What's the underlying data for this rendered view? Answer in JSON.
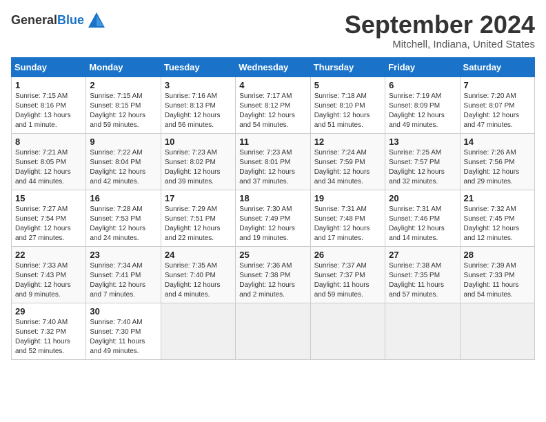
{
  "header": {
    "logo_line1": "General",
    "logo_line2": "Blue",
    "month_title": "September 2024",
    "location": "Mitchell, Indiana, United States"
  },
  "weekdays": [
    "Sunday",
    "Monday",
    "Tuesday",
    "Wednesday",
    "Thursday",
    "Friday",
    "Saturday"
  ],
  "weeks": [
    [
      {
        "day": "1",
        "info": "Sunrise: 7:15 AM\nSunset: 8:16 PM\nDaylight: 13 hours\nand 1 minute."
      },
      {
        "day": "2",
        "info": "Sunrise: 7:15 AM\nSunset: 8:15 PM\nDaylight: 12 hours\nand 59 minutes."
      },
      {
        "day": "3",
        "info": "Sunrise: 7:16 AM\nSunset: 8:13 PM\nDaylight: 12 hours\nand 56 minutes."
      },
      {
        "day": "4",
        "info": "Sunrise: 7:17 AM\nSunset: 8:12 PM\nDaylight: 12 hours\nand 54 minutes."
      },
      {
        "day": "5",
        "info": "Sunrise: 7:18 AM\nSunset: 8:10 PM\nDaylight: 12 hours\nand 51 minutes."
      },
      {
        "day": "6",
        "info": "Sunrise: 7:19 AM\nSunset: 8:09 PM\nDaylight: 12 hours\nand 49 minutes."
      },
      {
        "day": "7",
        "info": "Sunrise: 7:20 AM\nSunset: 8:07 PM\nDaylight: 12 hours\nand 47 minutes."
      }
    ],
    [
      {
        "day": "8",
        "info": "Sunrise: 7:21 AM\nSunset: 8:05 PM\nDaylight: 12 hours\nand 44 minutes."
      },
      {
        "day": "9",
        "info": "Sunrise: 7:22 AM\nSunset: 8:04 PM\nDaylight: 12 hours\nand 42 minutes."
      },
      {
        "day": "10",
        "info": "Sunrise: 7:23 AM\nSunset: 8:02 PM\nDaylight: 12 hours\nand 39 minutes."
      },
      {
        "day": "11",
        "info": "Sunrise: 7:23 AM\nSunset: 8:01 PM\nDaylight: 12 hours\nand 37 minutes."
      },
      {
        "day": "12",
        "info": "Sunrise: 7:24 AM\nSunset: 7:59 PM\nDaylight: 12 hours\nand 34 minutes."
      },
      {
        "day": "13",
        "info": "Sunrise: 7:25 AM\nSunset: 7:57 PM\nDaylight: 12 hours\nand 32 minutes."
      },
      {
        "day": "14",
        "info": "Sunrise: 7:26 AM\nSunset: 7:56 PM\nDaylight: 12 hours\nand 29 minutes."
      }
    ],
    [
      {
        "day": "15",
        "info": "Sunrise: 7:27 AM\nSunset: 7:54 PM\nDaylight: 12 hours\nand 27 minutes."
      },
      {
        "day": "16",
        "info": "Sunrise: 7:28 AM\nSunset: 7:53 PM\nDaylight: 12 hours\nand 24 minutes."
      },
      {
        "day": "17",
        "info": "Sunrise: 7:29 AM\nSunset: 7:51 PM\nDaylight: 12 hours\nand 22 minutes."
      },
      {
        "day": "18",
        "info": "Sunrise: 7:30 AM\nSunset: 7:49 PM\nDaylight: 12 hours\nand 19 minutes."
      },
      {
        "day": "19",
        "info": "Sunrise: 7:31 AM\nSunset: 7:48 PM\nDaylight: 12 hours\nand 17 minutes."
      },
      {
        "day": "20",
        "info": "Sunrise: 7:31 AM\nSunset: 7:46 PM\nDaylight: 12 hours\nand 14 minutes."
      },
      {
        "day": "21",
        "info": "Sunrise: 7:32 AM\nSunset: 7:45 PM\nDaylight: 12 hours\nand 12 minutes."
      }
    ],
    [
      {
        "day": "22",
        "info": "Sunrise: 7:33 AM\nSunset: 7:43 PM\nDaylight: 12 hours\nand 9 minutes."
      },
      {
        "day": "23",
        "info": "Sunrise: 7:34 AM\nSunset: 7:41 PM\nDaylight: 12 hours\nand 7 minutes."
      },
      {
        "day": "24",
        "info": "Sunrise: 7:35 AM\nSunset: 7:40 PM\nDaylight: 12 hours\nand 4 minutes."
      },
      {
        "day": "25",
        "info": "Sunrise: 7:36 AM\nSunset: 7:38 PM\nDaylight: 12 hours\nand 2 minutes."
      },
      {
        "day": "26",
        "info": "Sunrise: 7:37 AM\nSunset: 7:37 PM\nDaylight: 11 hours\nand 59 minutes."
      },
      {
        "day": "27",
        "info": "Sunrise: 7:38 AM\nSunset: 7:35 PM\nDaylight: 11 hours\nand 57 minutes."
      },
      {
        "day": "28",
        "info": "Sunrise: 7:39 AM\nSunset: 7:33 PM\nDaylight: 11 hours\nand 54 minutes."
      }
    ],
    [
      {
        "day": "29",
        "info": "Sunrise: 7:40 AM\nSunset: 7:32 PM\nDaylight: 11 hours\nand 52 minutes."
      },
      {
        "day": "30",
        "info": "Sunrise: 7:40 AM\nSunset: 7:30 PM\nDaylight: 11 hours\nand 49 minutes."
      },
      null,
      null,
      null,
      null,
      null
    ]
  ]
}
